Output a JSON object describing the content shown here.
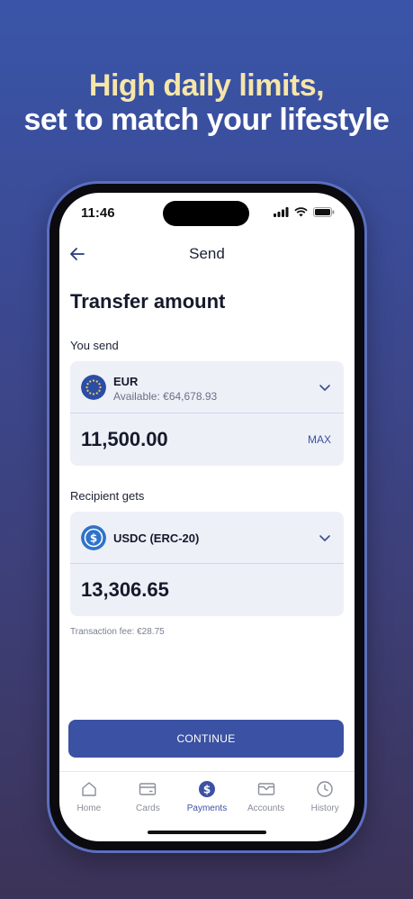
{
  "headline": {
    "line1": "High daily limits,",
    "line2": "set to match your lifestyle"
  },
  "status_bar": {
    "time": "11:46",
    "icons": [
      "signal-icon",
      "wifi-icon",
      "battery-icon"
    ]
  },
  "app_bar": {
    "back_icon": "arrow-left-icon",
    "title": "Send"
  },
  "page_title": "Transfer amount",
  "you_send": {
    "label": "You send",
    "currency": "EUR",
    "available": "Available: €64,678.93",
    "amount": "11,500.00",
    "max_label": "MAX"
  },
  "recipient_gets": {
    "label": "Recipient gets",
    "currency": "USDC (ERC-20)",
    "amount": "13,306.65"
  },
  "fee": "Transaction fee: €28.75",
  "continue_label": "CONTINUE",
  "tabs": [
    {
      "label": "Home",
      "icon": "home-icon"
    },
    {
      "label": "Cards",
      "icon": "card-icon"
    },
    {
      "label": "Payments",
      "icon": "dollar-icon",
      "active": true
    },
    {
      "label": "Accounts",
      "icon": "wallet-icon"
    },
    {
      "label": "History",
      "icon": "clock-icon"
    }
  ],
  "colors": {
    "accent": "#3b51a3",
    "headline_highlight": "#f6e6a8"
  }
}
